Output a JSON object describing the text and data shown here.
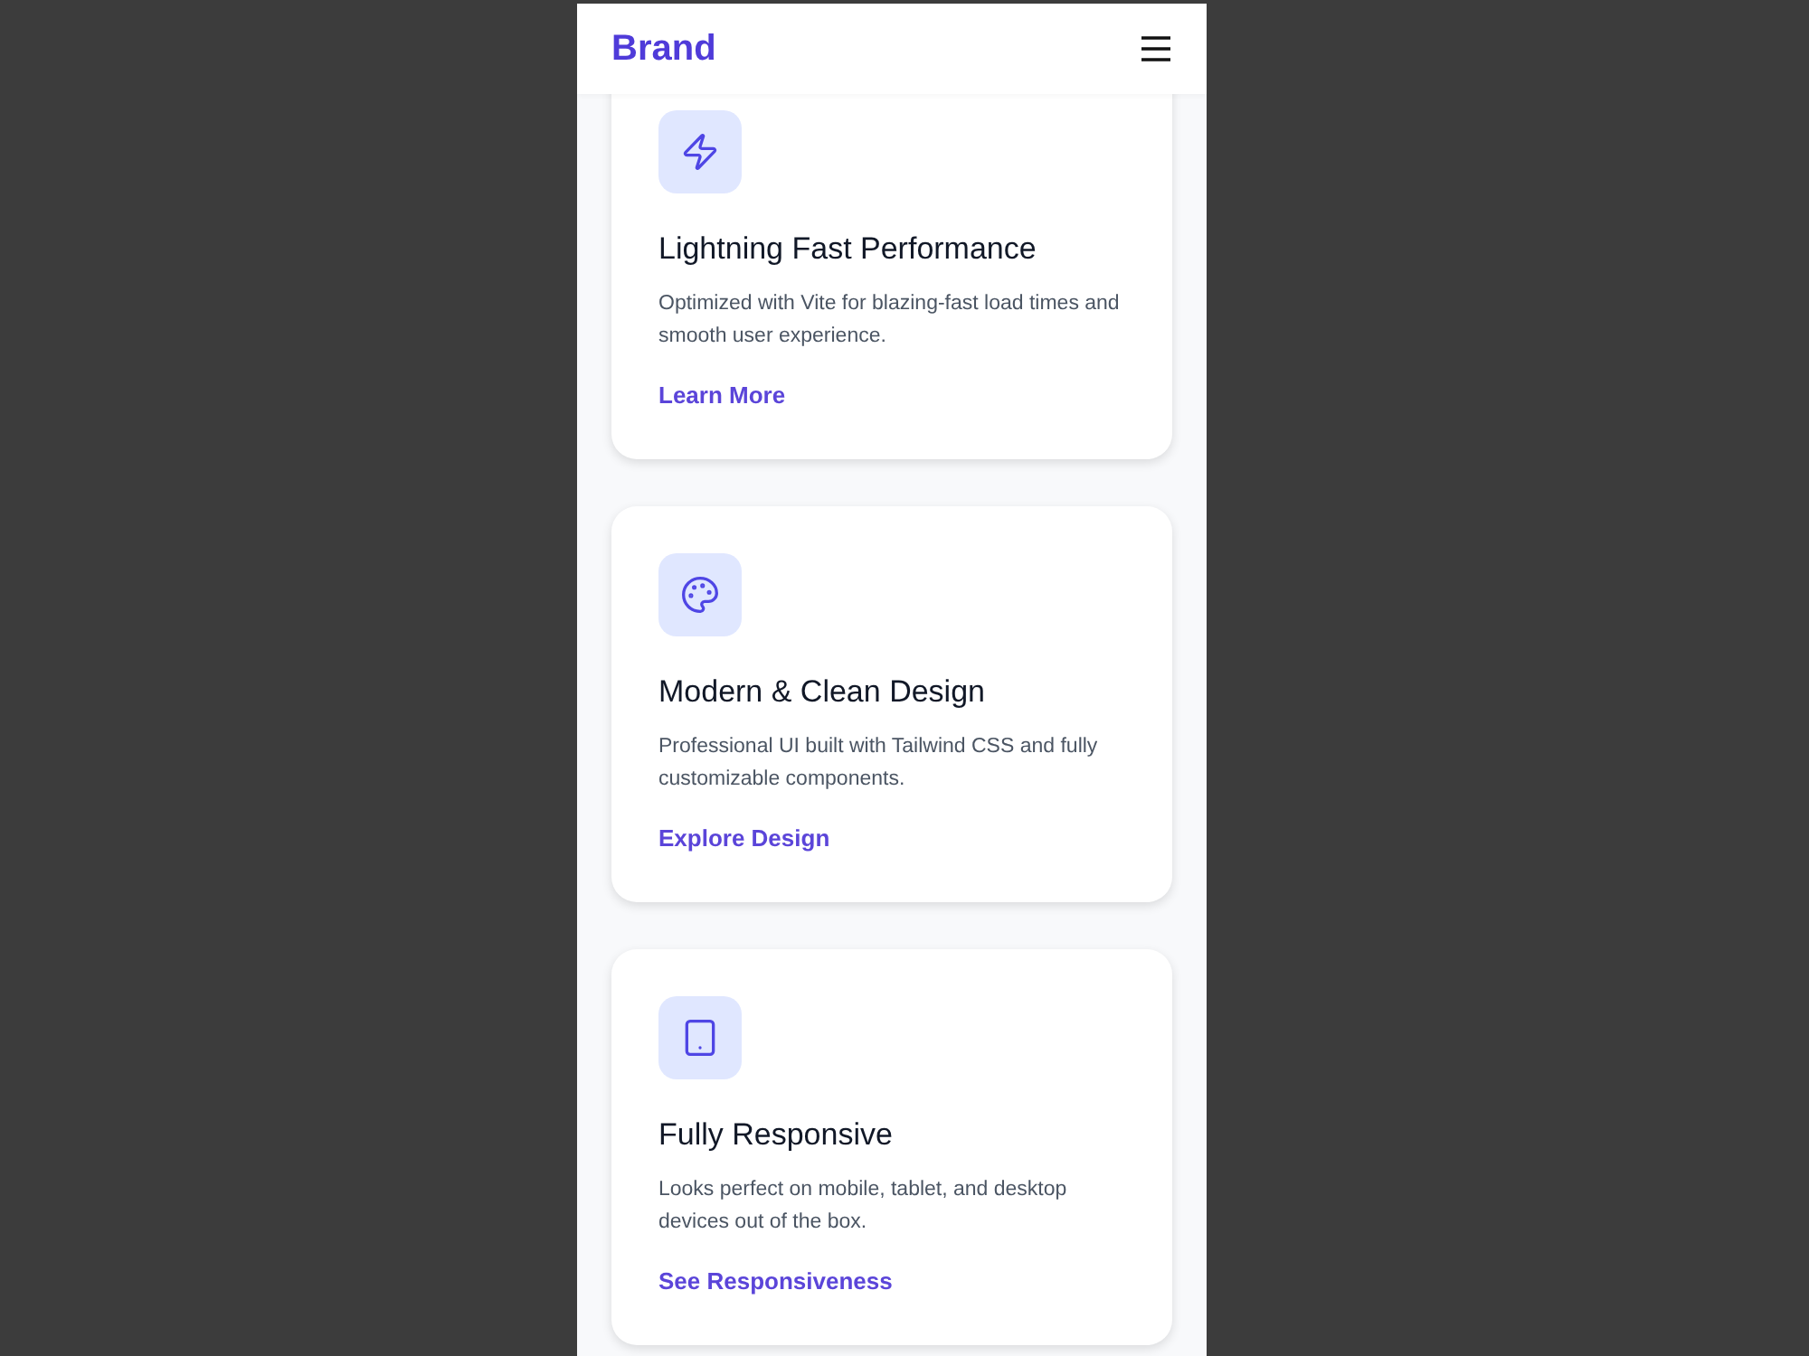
{
  "header": {
    "brand": "Brand"
  },
  "features": [
    {
      "kind": "lightning",
      "title": "Lightning Fast Performance",
      "description": "Optimized with Vite for blazing-fast load times and smooth user experience.",
      "link": "Learn More"
    },
    {
      "kind": "palette",
      "title": "Modern & Clean Design",
      "description": "Professional UI built with Tailwind CSS and fully customizable components.",
      "link": "Explore Design"
    },
    {
      "kind": "tablet",
      "title": "Fully Responsive",
      "description": "Looks perfect on mobile, tablet, and desktop devices out of the box.",
      "link": "See Responsiveness"
    }
  ]
}
